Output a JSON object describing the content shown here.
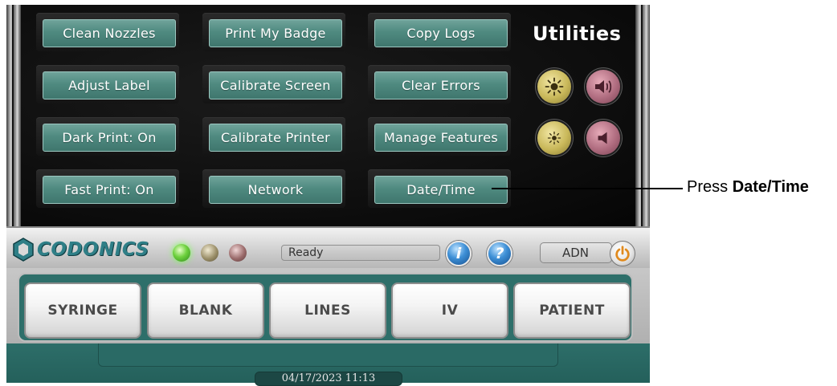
{
  "utilities": {
    "title": "Utilities",
    "buttons": {
      "clean_nozzles": "Clean Nozzles",
      "print_my_badge": "Print My Badge",
      "copy_logs": "Copy Logs",
      "adjust_label": "Adjust Label",
      "calibrate_screen": "Calibrate Screen",
      "clear_errors": "Clear Errors",
      "dark_print": "Dark Print: On",
      "calibrate_printer": "Calibrate Printer",
      "manage_features": "Manage Features",
      "fast_print": "Fast Print: On",
      "network": "Network",
      "date_time": "Date/Time"
    },
    "icons": {
      "brightness_up": "sun-icon",
      "volume_up": "speaker-loud-icon",
      "brightness_down": "sun-small-icon",
      "volume_down": "speaker-quiet-icon"
    }
  },
  "status": {
    "logo": "CODONICS",
    "message": "Ready",
    "info_glyph": "i",
    "help_glyph": "?",
    "user": "ADN"
  },
  "label_types": [
    "SYRINGE",
    "BLANK",
    "LINES",
    "IV",
    "PATIENT"
  ],
  "footer": {
    "datetime": "04/17/2023 11:13"
  },
  "callout": {
    "prefix": "Press ",
    "target": "Date/Time"
  },
  "colors": {
    "button_teal": "#4f8a80",
    "logo_teal": "#2f7f87",
    "led_green": "#6ed13e",
    "footer_teal": "#2d6e69"
  }
}
